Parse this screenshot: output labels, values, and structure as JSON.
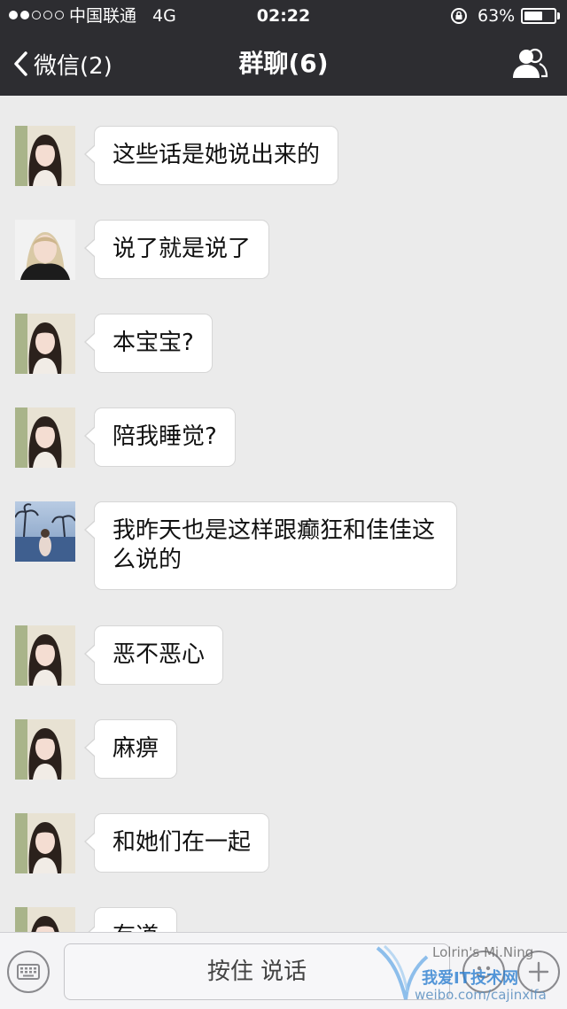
{
  "status_bar": {
    "carrier": "中国联通",
    "network": "4G",
    "time": "02:22",
    "battery_percent": "63%",
    "battery_level": 0.63,
    "signal_bars_filled": 2,
    "signal_bars_total": 5
  },
  "nav": {
    "back_label": "微信(2)",
    "title": "群聊(6)",
    "members_icon": "group-members-icon"
  },
  "avatars": {
    "girl": "avatar-long-hair-girl",
    "blonde": "avatar-blonde-girl",
    "resort": "avatar-resort-pool"
  },
  "messages": [
    {
      "avatar": "girl",
      "text": "这些话是她说出来的"
    },
    {
      "avatar": "blonde",
      "text": "说了就是说了"
    },
    {
      "avatar": "girl",
      "text": "本宝宝?"
    },
    {
      "avatar": "girl",
      "text": "陪我睡觉?"
    },
    {
      "avatar": "resort",
      "text": "我昨天也是这样跟癫狂和佳佳这么说的"
    },
    {
      "avatar": "girl",
      "text": "恶不恶心"
    },
    {
      "avatar": "girl",
      "text": "麻痹"
    },
    {
      "avatar": "girl",
      "text": "和她们在一起"
    },
    {
      "avatar": "girl",
      "text": "有道"
    }
  ],
  "input_bar": {
    "hold_to_talk": "按住 说话",
    "keyboard_icon": "keyboard-icon",
    "emoji_icon": "emoji-icon",
    "plus_icon": "plus-icon"
  },
  "watermark": {
    "line0": "Lolrin's Mi.Ning",
    "line1": "我爱IT技术网",
    "line2": "weibo.com/cajinxifa"
  },
  "colors": {
    "nav_bg": "#2d2d31",
    "chat_bg": "#ebebeb",
    "bubble_bg": "#ffffff"
  }
}
